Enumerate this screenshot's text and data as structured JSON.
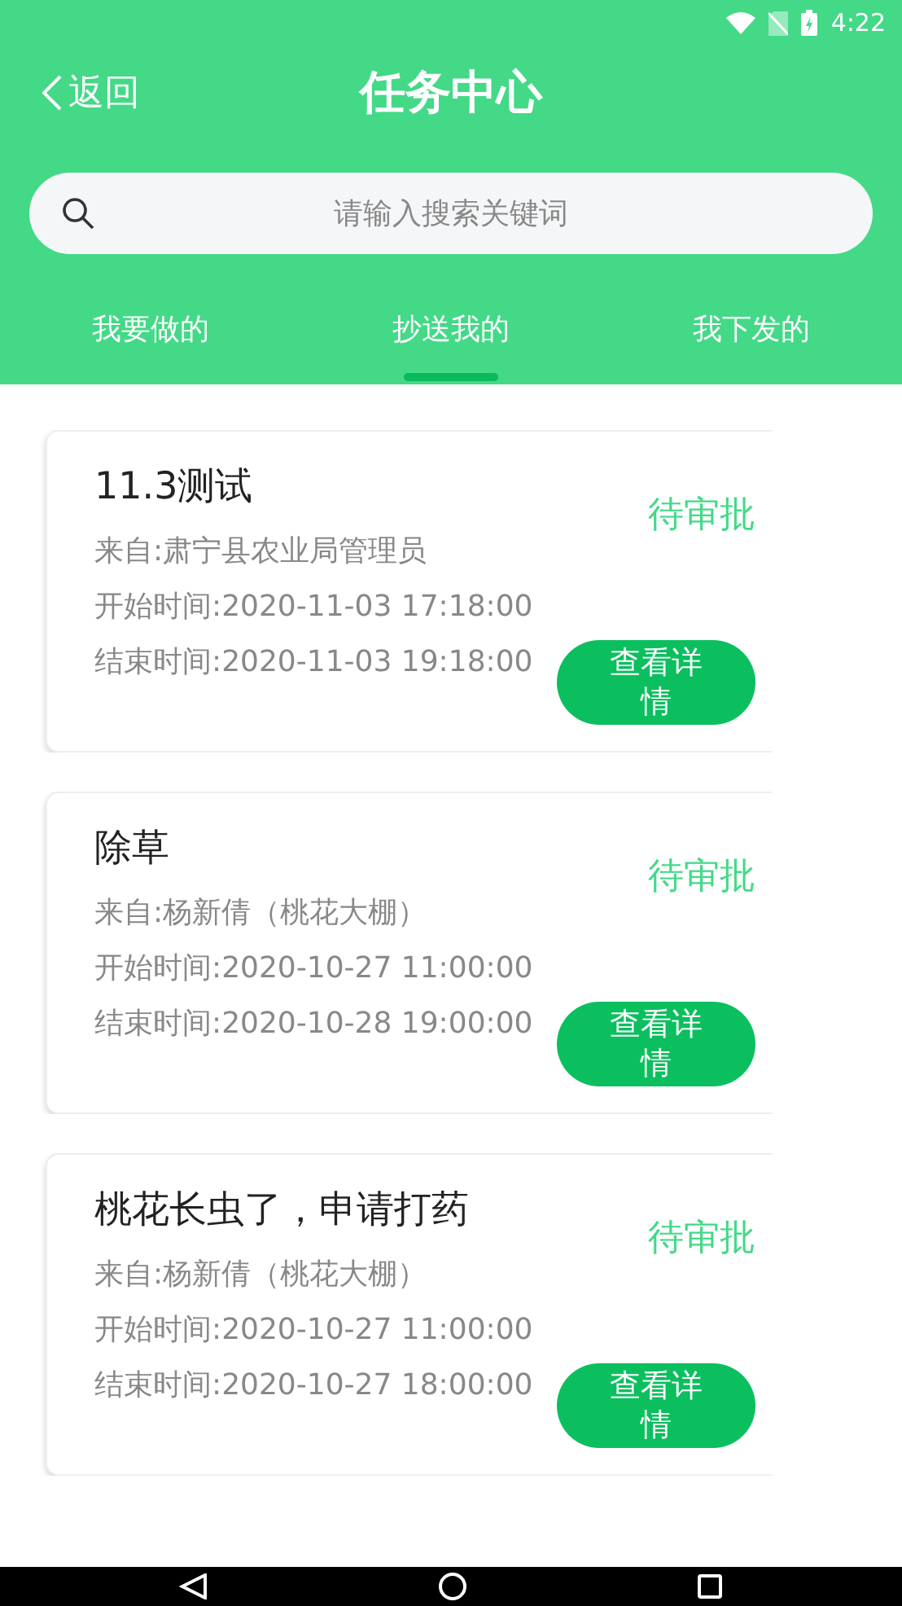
{
  "status_bar": {
    "time": "4:22"
  },
  "header": {
    "back": "返回",
    "title": "任务中心"
  },
  "search": {
    "placeholder": "请输入搜索关键词"
  },
  "tabs": [
    {
      "label": "我要做的",
      "selected": false
    },
    {
      "label": "抄送我的",
      "selected": true
    },
    {
      "label": "我下发的",
      "selected": false
    }
  ],
  "tasks": [
    {
      "title": "11.3测试",
      "from": "来自:肃宁县农业局管理员",
      "start": "开始时间:2020-11-03 17:18:00",
      "end": "结束时间:2020-11-03 19:18:00",
      "status": "待审批",
      "button": "查看详情"
    },
    {
      "title": "除草",
      "from": "来自:杨新倩（桃花大棚）",
      "start": "开始时间:2020-10-27 11:00:00",
      "end": "结束时间:2020-10-28 19:00:00",
      "status": "待审批",
      "button": "查看详情"
    },
    {
      "title": "桃花长虫了，申请打药",
      "from": "来自:杨新倩（桃花大棚）",
      "start": "开始时间:2020-10-27 11:00:00",
      "end": "结束时间:2020-10-27 18:00:00",
      "status": "待审批",
      "button": "查看详情"
    }
  ]
}
